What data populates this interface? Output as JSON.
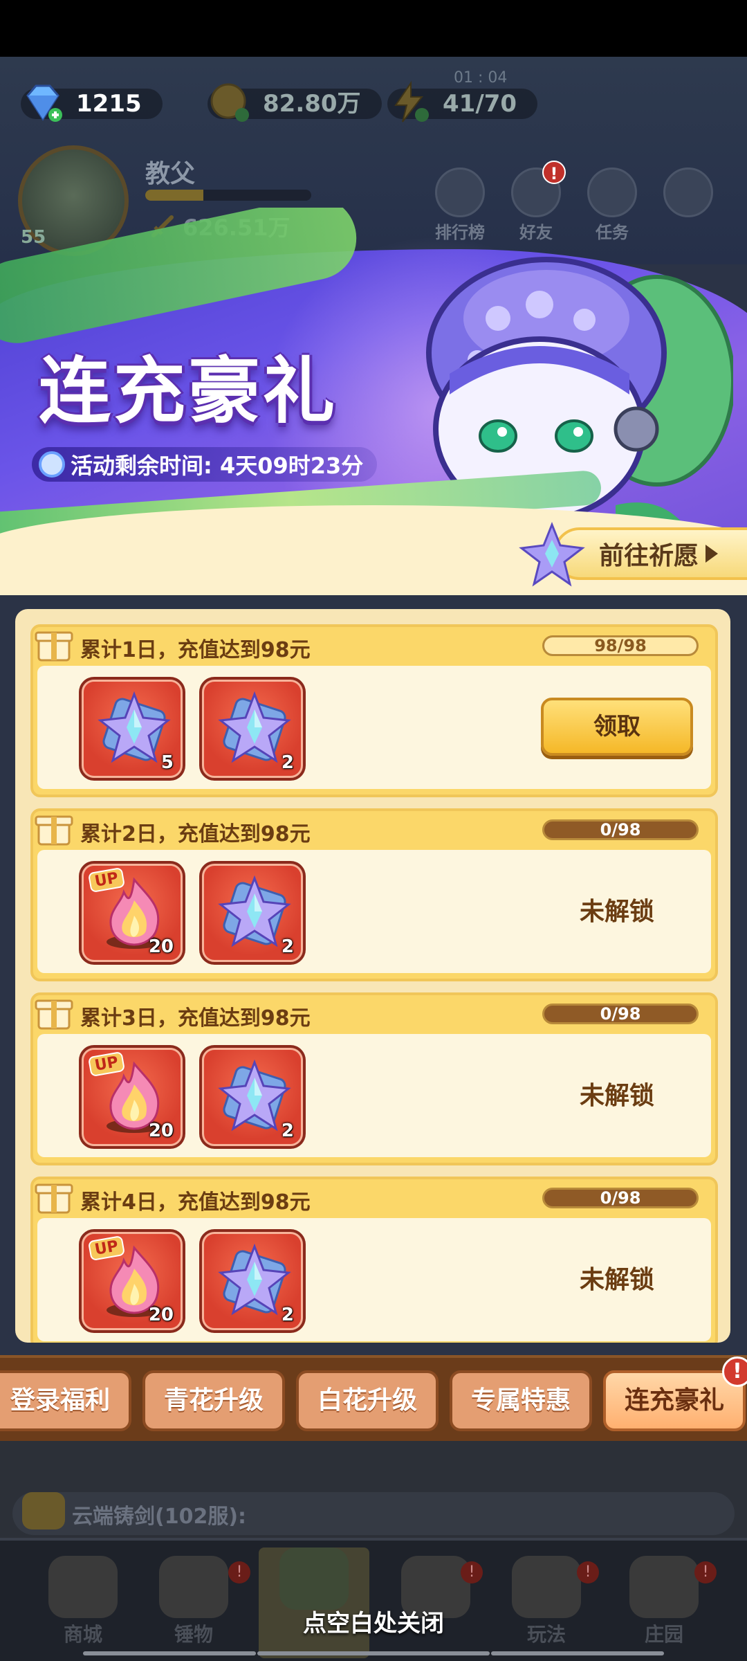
{
  "hud": {
    "gems": "1215",
    "gold": "82.80万",
    "energy": "41/70",
    "energy_timer": "01 : 04",
    "player_name": "教父",
    "player_level": "55",
    "power": "626.51万",
    "buttons": [
      {
        "label": "排行榜",
        "icon": "leaderboard-icon"
      },
      {
        "label": "好友",
        "icon": "friends-icon",
        "badge": "!"
      },
      {
        "label": "任务",
        "icon": "tasks-icon"
      },
      {
        "label": "",
        "icon": "more-icon"
      }
    ]
  },
  "banner": {
    "title": "连充豪礼",
    "countdown_label": "活动剩余时间: 4天09时23分",
    "wish_button": "前往祈愿"
  },
  "rewards": [
    {
      "title": "累计1日，充值达到98元",
      "progress_text": "98/98",
      "progress": 1.0,
      "items": [
        {
          "type": "star-crystal",
          "qty": "5"
        },
        {
          "type": "star-crystal",
          "qty": "2"
        }
      ],
      "action": "领取",
      "state": "claimable"
    },
    {
      "title": "累计2日，充值达到98元",
      "progress_text": "0/98",
      "progress": 0.0,
      "items": [
        {
          "type": "up-flame",
          "badge": "UP",
          "qty": "20"
        },
        {
          "type": "star-crystal",
          "qty": "2"
        }
      ],
      "action": "未解锁",
      "state": "locked"
    },
    {
      "title": "累计3日，充值达到98元",
      "progress_text": "0/98",
      "progress": 0.0,
      "items": [
        {
          "type": "up-flame",
          "badge": "UP",
          "qty": "20"
        },
        {
          "type": "star-crystal",
          "qty": "2"
        }
      ],
      "action": "未解锁",
      "state": "locked"
    },
    {
      "title": "累计4日，充值达到98元",
      "progress_text": "0/98",
      "progress": 0.0,
      "items": [
        {
          "type": "up-flame",
          "badge": "UP",
          "qty": "20"
        },
        {
          "type": "star-crystal",
          "qty": "2"
        }
      ],
      "action": "未解锁",
      "state": "locked"
    }
  ],
  "tabs": [
    {
      "label": "登录福利",
      "active": false
    },
    {
      "label": "青花升级",
      "active": false
    },
    {
      "label": "白花升级",
      "active": false
    },
    {
      "label": "专属特惠",
      "active": false
    },
    {
      "label": "连充豪礼",
      "active": true
    }
  ],
  "tab_badge": "!",
  "chat": {
    "text": "云端铸剑(102服):"
  },
  "nav": [
    {
      "label": "商城",
      "badge": ""
    },
    {
      "label": "锤物",
      "badge": "!"
    },
    {
      "label": "",
      "badge": ""
    },
    {
      "label": "",
      "badge": "!"
    },
    {
      "label": "玩法",
      "badge": "!"
    },
    {
      "label": "庄园",
      "badge": "!"
    }
  ],
  "close_hint": "点空白处关闭",
  "colors": {
    "panel": "#f8e6b6",
    "card": "#fbd769",
    "accent_text": "#6b3d12",
    "tab_bar": "#6b3c1a",
    "banner_purple": "#6a54e8"
  }
}
